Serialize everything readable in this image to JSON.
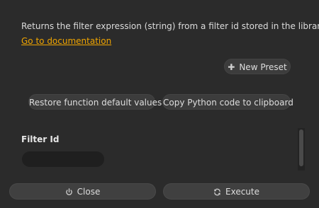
{
  "description": "Returns the filter expression (string) from a filter id stored in the library",
  "doc_link": "Go to documentation",
  "presets": {
    "new_preset_label": "New Preset",
    "new_preset_icon": "plus-icon"
  },
  "actions": {
    "restore_label": "Restore function default values",
    "copy_label": "Copy Python code to clipboard"
  },
  "fields": {
    "filter_id_label": "Filter Id",
    "filter_id_value": "",
    "filter_id_placeholder": ""
  },
  "footer": {
    "close_label": "Close",
    "close_icon": "power-icon",
    "execute_label": "Execute",
    "execute_icon": "refresh-icon"
  },
  "colors": {
    "background": "#2b2b2b",
    "link": "#f0a500",
    "button": "#3c3c3c",
    "input": "#1f1f1f"
  }
}
